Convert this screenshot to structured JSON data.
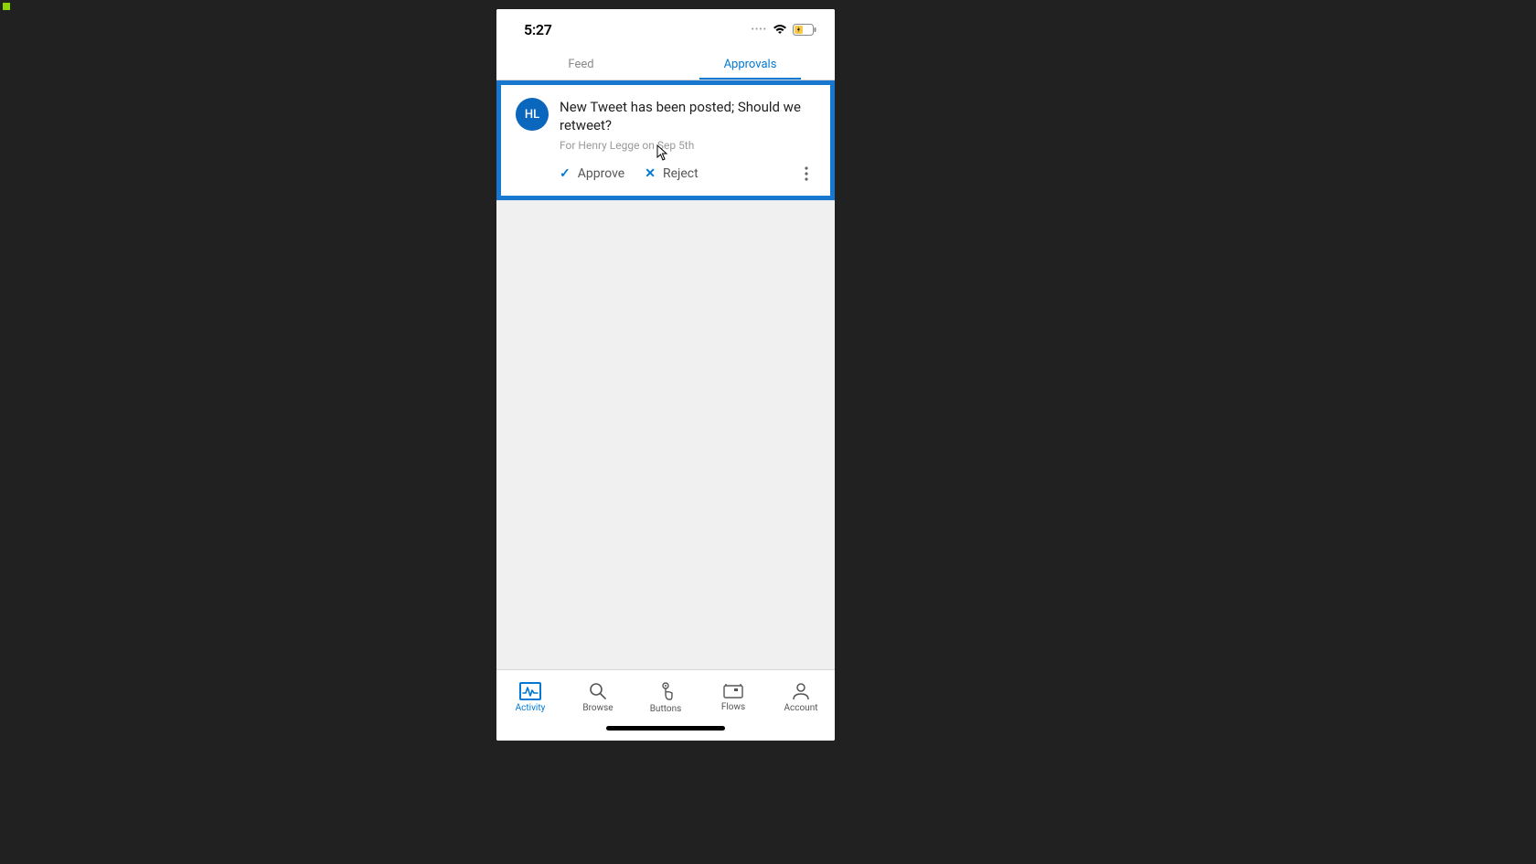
{
  "status_bar": {
    "time": "5:27"
  },
  "tabs": {
    "feed_label": "Feed",
    "approvals_label": "Approvals"
  },
  "approval": {
    "avatar_initials": "HL",
    "title": "New Tweet has been posted; Should we retweet?",
    "meta": "For Henry Legge on Sep 5th",
    "approve_label": "Approve",
    "reject_label": "Reject"
  },
  "bottom_nav": {
    "activity": "Activity",
    "browse": "Browse",
    "buttons": "Buttons",
    "flows": "Flows",
    "account": "Account"
  }
}
